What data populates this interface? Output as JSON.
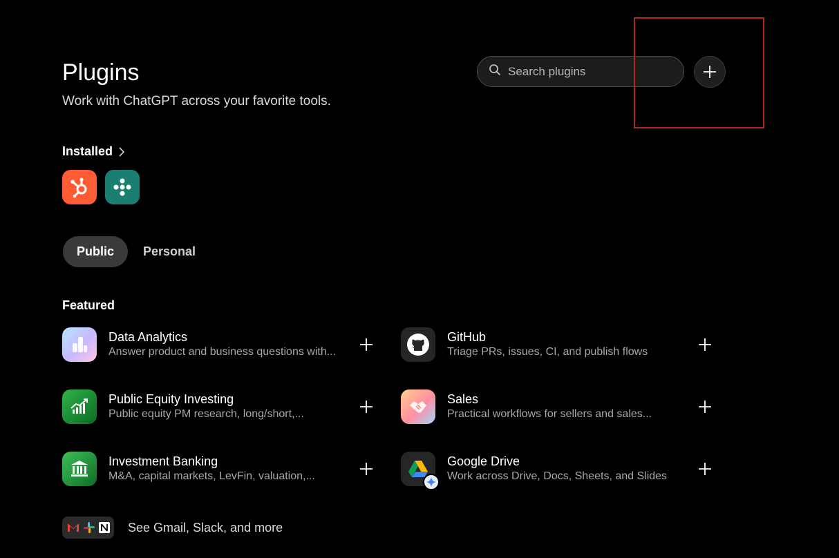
{
  "header": {
    "title": "Plugins",
    "subtitle": "Work with ChatGPT across your favorite tools."
  },
  "search": {
    "placeholder": "Search plugins"
  },
  "installed": {
    "label": "Installed",
    "apps": [
      {
        "icon": "hubspot-icon",
        "color": "#ff5c35"
      },
      {
        "icon": "connector-icon",
        "color": "#1a7f70"
      }
    ]
  },
  "tabs": [
    {
      "label": "Public",
      "active": true
    },
    {
      "label": "Personal",
      "active": false
    }
  ],
  "featured": {
    "label": "Featured",
    "plugins": [
      {
        "name": "Data Analytics",
        "desc": "Answer product and business questions with...",
        "icon": "data-analytics-icon"
      },
      {
        "name": "GitHub",
        "desc": "Triage PRs, issues, CI, and publish flows",
        "icon": "github-icon"
      },
      {
        "name": "Public Equity Investing",
        "desc": "Public equity PM research, long/short,...",
        "icon": "stock-chart-icon"
      },
      {
        "name": "Sales",
        "desc": "Practical workflows for sellers and sales...",
        "icon": "handshake-icon"
      },
      {
        "name": "Investment Banking",
        "desc": "M&A, capital markets, LevFin, valuation,...",
        "icon": "bank-icon"
      },
      {
        "name": "Google Drive",
        "desc": "Work across Drive, Docs, Sheets, and Slides",
        "icon": "google-drive-icon"
      }
    ]
  },
  "see_more": {
    "label": "See Gmail, Slack, and more"
  },
  "colors": {
    "background": "#000000",
    "highlight": "#b3261e",
    "tab_active": "#3a3a3a"
  }
}
